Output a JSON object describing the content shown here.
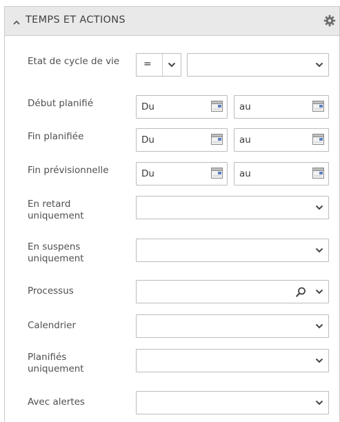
{
  "panel": {
    "title": "TEMPS ET ACTIONS",
    "collapse_icon": "chevron-up-icon",
    "settings_icon": "gear-icon"
  },
  "fields": {
    "etat_cycle_vie": {
      "label": "Etat de cycle de vie",
      "operator": "=",
      "value": ""
    },
    "debut_planifie": {
      "label": "Début planifié",
      "from_placeholder": "Du",
      "to_placeholder": "au"
    },
    "fin_planifiee": {
      "label": "Fin planifiée",
      "from_placeholder": "Du",
      "to_placeholder": "au"
    },
    "fin_previsionnelle": {
      "label": "Fin prévisionnelle",
      "from_placeholder": "Du",
      "to_placeholder": "au"
    },
    "en_retard": {
      "label": "En retard uniquement",
      "value": ""
    },
    "en_suspens": {
      "label": "En suspens uniquement",
      "value": ""
    },
    "processus": {
      "label": "Processus",
      "value": ""
    },
    "calendrier": {
      "label": "Calendrier",
      "value": ""
    },
    "planifies": {
      "label": "Planifiés uniquement",
      "value": ""
    },
    "avec_alertes": {
      "label": "Avec alertes",
      "value": ""
    }
  },
  "colors": {
    "header_bg": "#e9e9e9",
    "border": "#bcbcbc",
    "label_text": "#4f4f4f"
  }
}
